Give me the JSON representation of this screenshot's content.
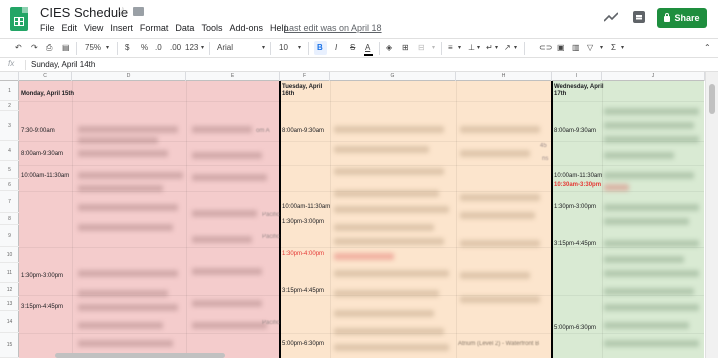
{
  "app": {
    "title": "CIES Schedule",
    "menu": [
      "File",
      "Edit",
      "View",
      "Insert",
      "Format",
      "Data",
      "Tools",
      "Add-ons",
      "Help"
    ],
    "last_edit": "Last edit was on April 18",
    "share_label": "Share",
    "accent": "#1e8e3e"
  },
  "toolbar": {
    "zoom": "75%",
    "currency": "$",
    "percent": "%",
    "dec_decrease": ".0",
    "dec_increase": ".00",
    "number_format": "123",
    "font": "Arial",
    "font_size": "10",
    "bold": "B",
    "italic": "I",
    "strike": "S",
    "text_color": "A"
  },
  "formula": {
    "fx": "fx",
    "value": "Sunday, April 14th"
  },
  "columns": [
    "C",
    "D",
    "E",
    "F",
    "G",
    "H",
    "I",
    "J"
  ],
  "rows": [
    "1",
    "2",
    "3",
    "4",
    "5",
    "6",
    "7",
    "8",
    "9",
    "10",
    "11",
    "12",
    "13",
    "14",
    "15"
  ],
  "days": {
    "monday": {
      "header": "Monday, April 15th",
      "times": [
        {
          "text": "7:30-9:00am",
          "red": false
        },
        {
          "text": "8:00am-9:30am",
          "red": false
        },
        {
          "text": "10:00am-11:30am",
          "red": false
        },
        {
          "text": "1:30pm-3:00pm",
          "red": false
        },
        {
          "text": "3:15pm-4:45pm",
          "red": false
        }
      ],
      "fragments": [
        "om A",
        "Pacific",
        "Pacific",
        "Pacific"
      ]
    },
    "tuesday": {
      "header_line1": "Tuesday, April",
      "header_line2": "16th",
      "times": [
        {
          "text": "8:00am-9:30am",
          "red": false
        },
        {
          "text": "10:00am-11:30am",
          "red": false
        },
        {
          "text": "1:30pm-3:00pm",
          "red": false
        },
        {
          "text": "1:30pm-4:00pm",
          "red": true
        },
        {
          "text": "3:15pm-4:45pm",
          "red": false
        },
        {
          "text": "5:00pm-6:30pm",
          "red": false
        }
      ],
      "fragments": [
        "45",
        "ns",
        "Atrium (Level 2) - Waterfront B"
      ]
    },
    "wednesday": {
      "header_line1": "Wednesday, April",
      "header_line2": "17th",
      "times": [
        {
          "text": "8:00am-9:30am",
          "red": false
        },
        {
          "text": "10:00am-11:30am",
          "red": false
        },
        {
          "text": "10:30am-3:30pm",
          "red": true
        },
        {
          "text": "1:30pm-3:00pm",
          "red": false
        },
        {
          "text": "3:15pm-4:45pm",
          "red": false
        },
        {
          "text": "5:00pm-6:30pm",
          "red": false
        }
      ]
    }
  },
  "colors": {
    "monday_bg": "#f4cccc",
    "tuesday_bg": "#fce5cd",
    "wednesday_bg": "#d9ead3",
    "alert_text": "#e53935"
  }
}
